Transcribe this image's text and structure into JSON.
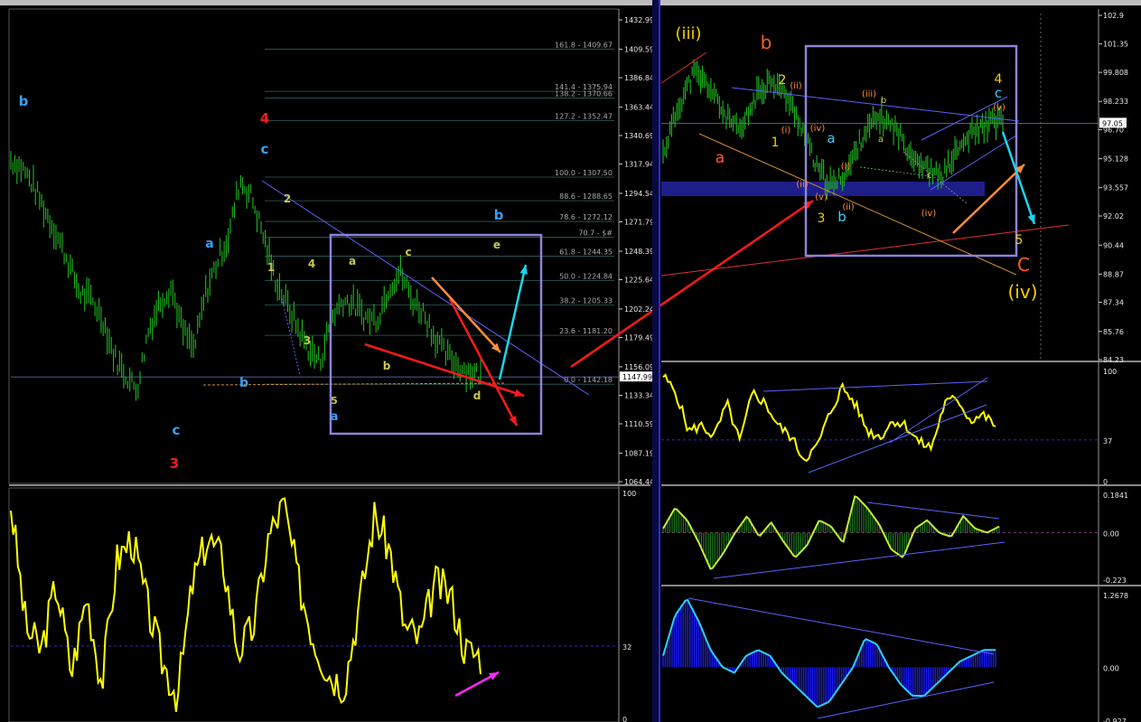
{
  "colors": {
    "background": "#000000",
    "bars": "#1fb81f",
    "oscillator": "#ffff00",
    "trendline": "#5a63ff",
    "box": "#8a84d8",
    "arrow_red": "#ff1a1a",
    "arrow_orange": "#ff8c3a",
    "arrow_cyan": "#19d7f0",
    "arrow_magenta": "#ff2aff",
    "histogram_green": "#1e7a1e",
    "histogram_blue": "#1a1aff",
    "support_band": "#1e1e8a"
  },
  "left": {
    "price_axis": [
      "1432.99",
      "1409.59",
      "1386.84",
      "1363.44",
      "1340.69",
      "1317.94",
      "1294.54",
      "1271.79",
      "1248.39",
      "1225.64",
      "1202.24",
      "1179.49",
      "1156.09",
      "1133.34",
      "1110.59",
      "1087.19",
      "1064.44"
    ],
    "current_price": "1147.99",
    "fib_levels": [
      "161.8 - 1409.67",
      "141.4 - 1375.94",
      "138.2 - 1370.66",
      "127.2 - 1352.47",
      "100.0 - 1307.50",
      "88.6 - 1288.65",
      "78.6 - 1272.12",
      "70.7 - $#",
      "61.8 - 1244.35",
      "50.0 - 1224.84",
      "38.2 - 1205.33",
      "23.6 - 1181.20",
      "0.0 - 1142.18"
    ],
    "wave_labels": [
      "b",
      "a",
      "b",
      "c",
      "3",
      "4",
      "c",
      "2",
      "1",
      "4",
      "3",
      "5",
      "a",
      "a",
      "b",
      "c",
      "d",
      "e",
      "b"
    ],
    "oscillator_axis": [
      "100",
      "32",
      "0"
    ]
  },
  "right": {
    "price_axis": [
      "102.9",
      "101.35",
      "99.808",
      "98.233",
      "96.70",
      "95.128",
      "93.557",
      "92.02",
      "90.44",
      "88.87",
      "87.34",
      "85.76",
      "84.23"
    ],
    "current_price": "97.05",
    "wave_labels": [
      "(iii)",
      "b",
      "a",
      "2",
      "(ii)",
      "1",
      "(i)",
      "(iv)",
      "(iii)",
      "b",
      "a",
      "a",
      "(i)",
      "(ii)",
      "(v)",
      "(ii)",
      "3",
      "b",
      "c",
      "(iv)",
      "4",
      "c",
      "(v)",
      "5",
      "C",
      "(iv)"
    ],
    "rsi_axis": [
      "100",
      "37",
      "0"
    ],
    "osc_axis": [
      "0.1841",
      "0.00",
      "-0.223"
    ],
    "macd_axis": [
      "1.2678",
      "0.00",
      "-0.927"
    ]
  },
  "chart_data": [
    {
      "type": "line",
      "title": "",
      "note": "Left price chart (OHLC bars) – approximate closes",
      "y": [
        1321,
        1315,
        1300,
        1280,
        1262,
        1240,
        1215,
        1210,
        1195,
        1165,
        1150,
        1138,
        1185,
        1208,
        1220,
        1185,
        1170,
        1215,
        1240,
        1260,
        1305,
        1292,
        1262,
        1228,
        1208,
        1188,
        1170,
        1160,
        1195,
        1210,
        1205,
        1195,
        1195,
        1220,
        1232,
        1210,
        1200,
        1180,
        1165,
        1158,
        1152,
        1150
      ],
      "ylim": [
        1064.44,
        1432.99
      ]
    },
    {
      "type": "line",
      "title": "",
      "note": "Left oscillator",
      "y": [
        95,
        40,
        30,
        60,
        20,
        55,
        15,
        70,
        80,
        50,
        25,
        10,
        60,
        80,
        70,
        30,
        40,
        80,
        95,
        60,
        35,
        20,
        15,
        50,
        90,
        75,
        40,
        35,
        60,
        55,
        30,
        28
      ],
      "ylim": [
        0,
        100
      ]
    },
    {
      "type": "line",
      "title": "",
      "note": "Right price chart – approximate closes",
      "y": [
        95.4,
        98.0,
        99.8,
        99.0,
        97.5,
        96.5,
        98.5,
        99.5,
        98.5,
        96.8,
        94.5,
        93.6,
        94.6,
        96.5,
        97.4,
        96.8,
        95.5,
        94.6,
        94.1,
        95.5,
        96.5,
        97.0,
        97.3
      ],
      "ylim": [
        84.23,
        102.9
      ]
    },
    {
      "type": "line",
      "title": "",
      "note": "Right RSI",
      "y": [
        95,
        80,
        45,
        50,
        40,
        70,
        35,
        80,
        70,
        50,
        40,
        20,
        30,
        60,
        85,
        70,
        45,
        40,
        55,
        50,
        35,
        30,
        70,
        75,
        55,
        60,
        50
      ],
      "ylim": [
        0,
        100
      ]
    },
    {
      "type": "area",
      "title": "",
      "note": "Right histogram oscillator",
      "y": [
        0.02,
        0.12,
        0.06,
        -0.05,
        -0.18,
        -0.1,
        0.0,
        0.08,
        -0.02,
        0.05,
        -0.04,
        -0.12,
        -0.06,
        0.06,
        0.03,
        -0.05,
        0.18,
        0.12,
        0.04,
        -0.08,
        -0.12,
        0.02,
        0.06,
        0.0,
        -0.02,
        0.08,
        0.02,
        0.0,
        0.03
      ],
      "ylim": [
        -0.223,
        0.1841
      ]
    },
    {
      "type": "area",
      "title": "",
      "note": "Right MACD histogram",
      "y": [
        0.2,
        0.9,
        1.2,
        0.8,
        0.3,
        0.0,
        -0.1,
        0.2,
        0.3,
        0.2,
        -0.1,
        -0.3,
        -0.5,
        -0.7,
        -0.6,
        -0.3,
        0.0,
        0.5,
        0.4,
        0.0,
        -0.3,
        -0.5,
        -0.5,
        -0.3,
        -0.1,
        0.1,
        0.2,
        0.3,
        0.3
      ],
      "ylim": [
        -0.927,
        1.2678
      ]
    }
  ]
}
